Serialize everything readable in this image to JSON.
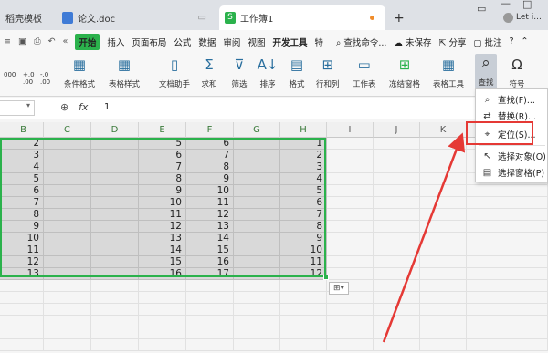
{
  "tabs": [
    {
      "label": "稻壳模板"
    },
    {
      "label": "论文.doc"
    },
    {
      "label": "工作簿1"
    }
  ],
  "new_tab_label": "+",
  "user_label": "Let i...",
  "menu": [
    "开始",
    "插入",
    "页面布局",
    "公式",
    "数据",
    "审阅",
    "视图",
    "开发工具",
    "特"
  ],
  "menu_right": {
    "search": "查找命令...",
    "unsaved": "未保存",
    "share": "分享",
    "comment": "批注",
    "help": "?"
  },
  "ribbon": {
    "format_values": [
      "000",
      "+.0 .00",
      "-.0 .00"
    ],
    "items": [
      {
        "label": "条件格式",
        "icon": "conditional-format-icon",
        "glyph": "▦"
      },
      {
        "label": "表格样式",
        "icon": "table-style-icon",
        "glyph": "▦"
      },
      {
        "label": "文档助手",
        "icon": "doc-assistant-icon",
        "glyph": "▯"
      },
      {
        "label": "求和",
        "icon": "sum-icon",
        "glyph": "Σ"
      },
      {
        "label": "筛选",
        "icon": "filter-icon",
        "glyph": "⊽"
      },
      {
        "label": "排序",
        "icon": "sort-icon",
        "glyph": "A↓"
      },
      {
        "label": "格式",
        "icon": "format-icon",
        "glyph": "▤"
      },
      {
        "label": "行和列",
        "icon": "rows-cols-icon",
        "glyph": "⊞"
      },
      {
        "label": "工作表",
        "icon": "worksheet-icon",
        "glyph": "▭"
      },
      {
        "label": "冻结窗格",
        "icon": "freeze-pane-icon",
        "glyph": "⊞"
      },
      {
        "label": "表格工具",
        "icon": "table-tools-icon",
        "glyph": "▦"
      },
      {
        "label": "查找",
        "icon": "find-icon",
        "glyph": "⌕"
      },
      {
        "label": "符号",
        "icon": "symbol-icon",
        "glyph": "Ω"
      }
    ]
  },
  "formula_bar": {
    "name_box": "",
    "fx": "fx",
    "value": "1"
  },
  "columns": [
    "B",
    "C",
    "D",
    "E",
    "F",
    "G",
    "H",
    "I",
    "J",
    "K"
  ],
  "rows": [
    {
      "B": "2",
      "E": "5",
      "F": "6",
      "H": "1"
    },
    {
      "B": "3",
      "E": "6",
      "F": "7",
      "H": "2"
    },
    {
      "B": "4",
      "E": "7",
      "F": "8",
      "H": "3"
    },
    {
      "B": "5",
      "E": "8",
      "F": "9",
      "H": "4"
    },
    {
      "B": "6",
      "E": "9",
      "F": "10",
      "H": "5"
    },
    {
      "B": "7",
      "E": "10",
      "F": "11",
      "H": "6"
    },
    {
      "B": "8",
      "E": "11",
      "F": "12",
      "H": "7"
    },
    {
      "B": "9",
      "E": "12",
      "F": "13",
      "H": "8"
    },
    {
      "B": "10",
      "E": "13",
      "F": "14",
      "H": "9"
    },
    {
      "B": "11",
      "E": "14",
      "F": "15",
      "H": "10"
    },
    {
      "B": "12",
      "E": "15",
      "F": "16",
      "H": "11"
    },
    {
      "B": "13",
      "E": "16",
      "F": "17",
      "H": "12"
    }
  ],
  "dropdown": [
    {
      "label": "查找(F)...",
      "icon": "search-icon",
      "glyph": "⌕"
    },
    {
      "label": "替换(R)...",
      "icon": "replace-icon",
      "glyph": "⇄"
    },
    {
      "label": "定位(S)...",
      "icon": "locate-icon",
      "glyph": "⌖"
    },
    {
      "label": "选择对象(O)",
      "icon": "select-object-icon",
      "glyph": "↖"
    },
    {
      "label": "选择窗格(P)",
      "icon": "select-pane-icon",
      "glyph": "▤"
    }
  ],
  "colors": {
    "accent": "#2bb24c",
    "highlight": "#e53935",
    "selection_fill": "#d9d9d9"
  }
}
